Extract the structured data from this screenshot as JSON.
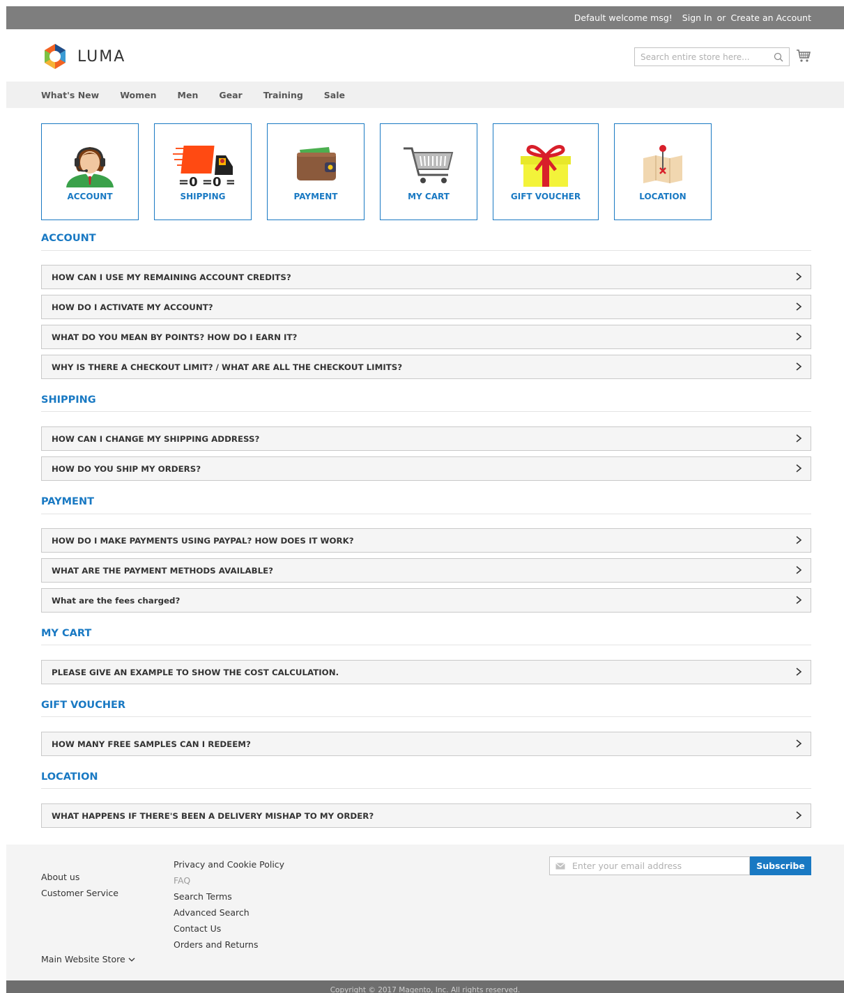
{
  "topbar": {
    "welcome": "Default welcome msg!",
    "sign_in": "Sign In",
    "or": "or",
    "create_account": "Create an Account"
  },
  "header": {
    "logo_text": "LUMA",
    "search_placeholder": "Search entire store here...",
    "search_value": ""
  },
  "nav": {
    "items": [
      "What's New",
      "Women",
      "Men",
      "Gear",
      "Training",
      "Sale"
    ]
  },
  "tiles": [
    {
      "label": "ACCOUNT",
      "icon": "customer-support-icon"
    },
    {
      "label": "SHIPPING",
      "icon": "delivery-truck-icon"
    },
    {
      "label": "PAYMENT",
      "icon": "wallet-icon"
    },
    {
      "label": "MY CART",
      "icon": "shopping-cart-icon"
    },
    {
      "label": "GIFT VOUCHER",
      "icon": "gift-box-icon"
    },
    {
      "label": "LOCATION",
      "icon": "map-pin-icon"
    }
  ],
  "sections": [
    {
      "title": "ACCOUNT",
      "questions": [
        "HOW CAN I USE MY REMAINING ACCOUNT CREDITS?",
        "HOW DO I ACTIVATE MY ACCOUNT?",
        "WHAT DO YOU MEAN BY POINTS? HOW DO I EARN IT?",
        "WHY IS THERE A CHECKOUT LIMIT? / WHAT ARE ALL THE CHECKOUT LIMITS?"
      ]
    },
    {
      "title": "SHIPPING",
      "questions": [
        "HOW CAN I CHANGE MY SHIPPING ADDRESS?",
        "HOW DO YOU SHIP MY ORDERS?"
      ]
    },
    {
      "title": "PAYMENT",
      "questions": [
        "HOW DO I MAKE PAYMENTS USING PAYPAL? HOW DOES IT WORK?",
        "WHAT ARE THE PAYMENT METHODS AVAILABLE?",
        "What are the fees charged?"
      ]
    },
    {
      "title": "MY CART",
      "questions": [
        "PLEASE GIVE AN EXAMPLE TO SHOW THE COST CALCULATION."
      ]
    },
    {
      "title": "GIFT VOUCHER",
      "questions": [
        "HOW MANY FREE SAMPLES CAN I REDEEM?"
      ]
    },
    {
      "title": "LOCATION",
      "questions": [
        "WHAT HAPPENS IF THERE'S BEEN A DELIVERY MISHAP TO MY ORDER?"
      ]
    }
  ],
  "footer": {
    "links_col1": [
      "About us",
      "Customer Service"
    ],
    "links_col2": [
      "Privacy and Cookie Policy",
      "FAQ",
      "Search Terms",
      "Advanced Search",
      "Contact Us",
      "Orders and Returns"
    ],
    "newsletter_placeholder": "Enter your email address",
    "subscribe_label": "Subscribe",
    "store_switcher": "Main Website Store",
    "copyright": "Copyright © 2017 Magento, Inc. All rights reserved."
  },
  "colors": {
    "accent": "#1979c3",
    "topbar": "#7e7e7e",
    "nav_bg": "#f0f0f0",
    "faq_bg": "#f5f5f5"
  }
}
